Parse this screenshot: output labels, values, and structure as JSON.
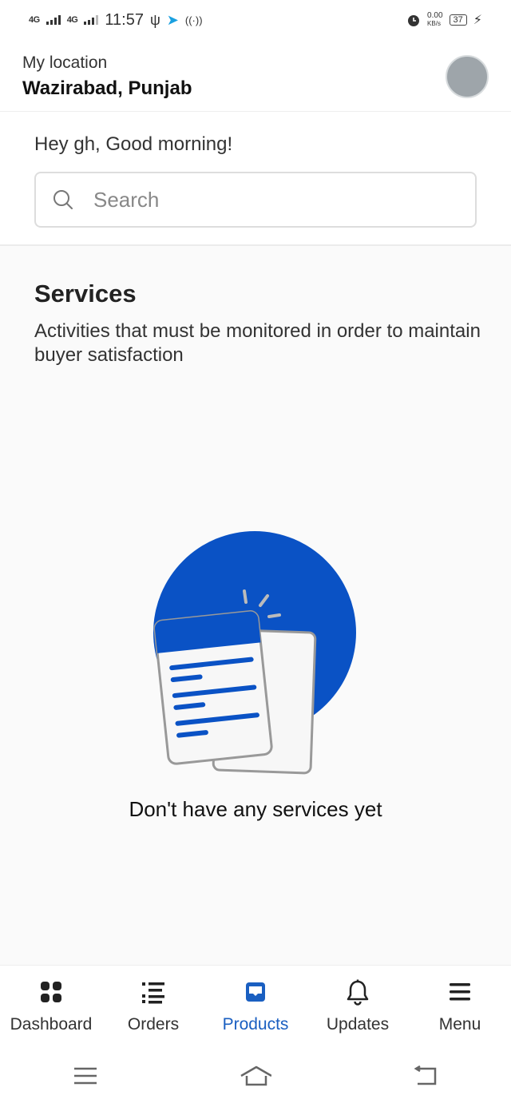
{
  "status_bar": {
    "network_1": "4G",
    "network_2": "4G",
    "time": "11:57",
    "speed": "0.00",
    "speed_unit": "KB/s",
    "battery": "37",
    "icons": [
      "signal-icon",
      "usb-icon",
      "carrier-icon",
      "hotspot-icon",
      "alarm-icon",
      "charging-icon"
    ]
  },
  "header": {
    "location_label": "My location",
    "location_value": "Wazirabad, Punjab"
  },
  "greeting": "Hey gh, Good morning!",
  "search": {
    "placeholder": "Search"
  },
  "services": {
    "title": "Services",
    "description": "Activities that must be monitored in order to maintain buyer satisfaction",
    "empty_text": "Don't have any services yet"
  },
  "bottom_nav": {
    "items": [
      {
        "label": "Dashboard",
        "icon": "dashboard-icon"
      },
      {
        "label": "Orders",
        "icon": "orders-icon"
      },
      {
        "label": "Products",
        "icon": "products-icon",
        "active": true
      },
      {
        "label": "Updates",
        "icon": "bell-icon"
      },
      {
        "label": "Menu",
        "icon": "menu-icon"
      }
    ]
  },
  "colors": {
    "accent": "#1a5fc1",
    "illustration_blue": "#0a52c5"
  }
}
